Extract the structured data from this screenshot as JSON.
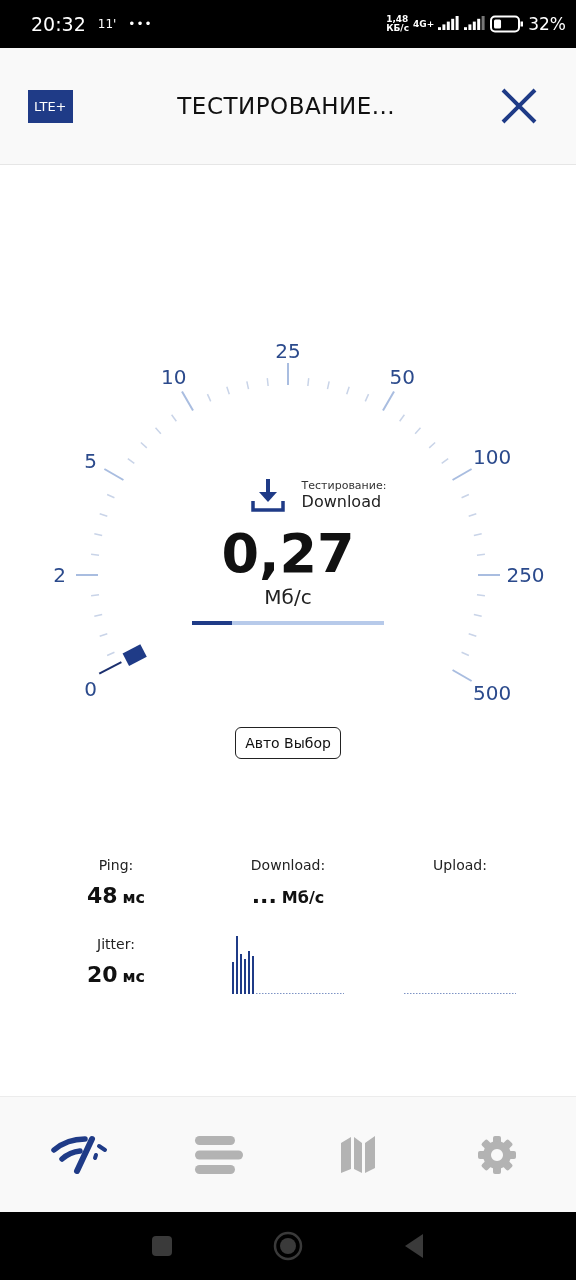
{
  "status_bar": {
    "time": "20:32",
    "notification": "11'",
    "more": "•••",
    "data_rate": "1,48",
    "data_unit": "КБ/с",
    "network": "4G+",
    "battery": "32%"
  },
  "header": {
    "badge": "LTE+",
    "title": "ТЕСТИРОВАНИЕ..."
  },
  "gauge": {
    "scale": [
      "0",
      "2",
      "5",
      "10",
      "25",
      "50",
      "100",
      "250",
      "500"
    ],
    "phase_label": "Тестирование:",
    "phase": "Download",
    "value": "0,27",
    "unit": "Мб/с",
    "progress": {
      "level": 0.21
    }
  },
  "mode_button": "Авто Выбор",
  "stats": [
    {
      "label": "Ping:",
      "value": "48",
      "unit": "мс"
    },
    {
      "label": "Download:",
      "value": "...",
      "unit": "Мб/с"
    },
    {
      "label": "Upload:"
    }
  ],
  "jitter": {
    "label": "Jitter:",
    "value": "20",
    "unit": "мс"
  },
  "nav": [
    {
      "kind": "speed",
      "selected": true
    },
    {
      "kind": "results",
      "selected": false
    },
    {
      "kind": "map",
      "selected": false
    },
    {
      "kind": "settings",
      "selected": false
    }
  ]
}
